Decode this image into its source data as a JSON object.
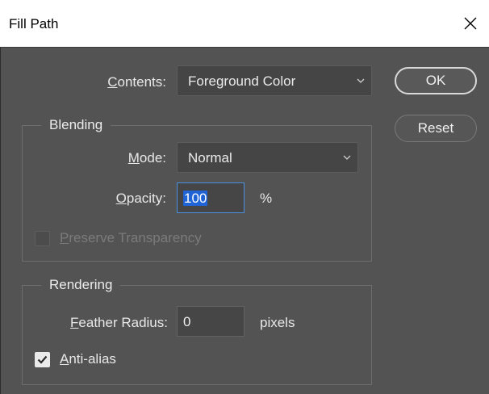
{
  "window": {
    "title": "Fill Path"
  },
  "contents": {
    "label_prefix": "",
    "label_mnemonic": "C",
    "label_rest": "ontents:",
    "value": "Foreground Color"
  },
  "buttons": {
    "ok": "OK",
    "reset": "Reset"
  },
  "blending": {
    "group_title": "Blending",
    "mode": {
      "label_mnemonic": "M",
      "label_rest": "ode:",
      "value": "Normal"
    },
    "opacity": {
      "label_mnemonic": "O",
      "label_rest": "pacity:",
      "value": "100",
      "unit": "%"
    },
    "preserve_transparency": {
      "label_mnemonic": "P",
      "label_rest": "reserve Transparency",
      "checked": false,
      "enabled": false
    }
  },
  "rendering": {
    "group_title": "Rendering",
    "feather_radius": {
      "label_mnemonic": "F",
      "label_rest": "eather Radius:",
      "value": "0",
      "unit": "pixels"
    },
    "anti_alias": {
      "label_mnemonic": "A",
      "label_rest": "nti-alias",
      "checked": true
    }
  },
  "icons": {
    "close": "close-icon",
    "chevron": "chevron-down-icon",
    "check": "checkmark-icon"
  },
  "colors": {
    "background": "#535353",
    "accent": "#1f63d5",
    "focus": "#4a90e2"
  }
}
